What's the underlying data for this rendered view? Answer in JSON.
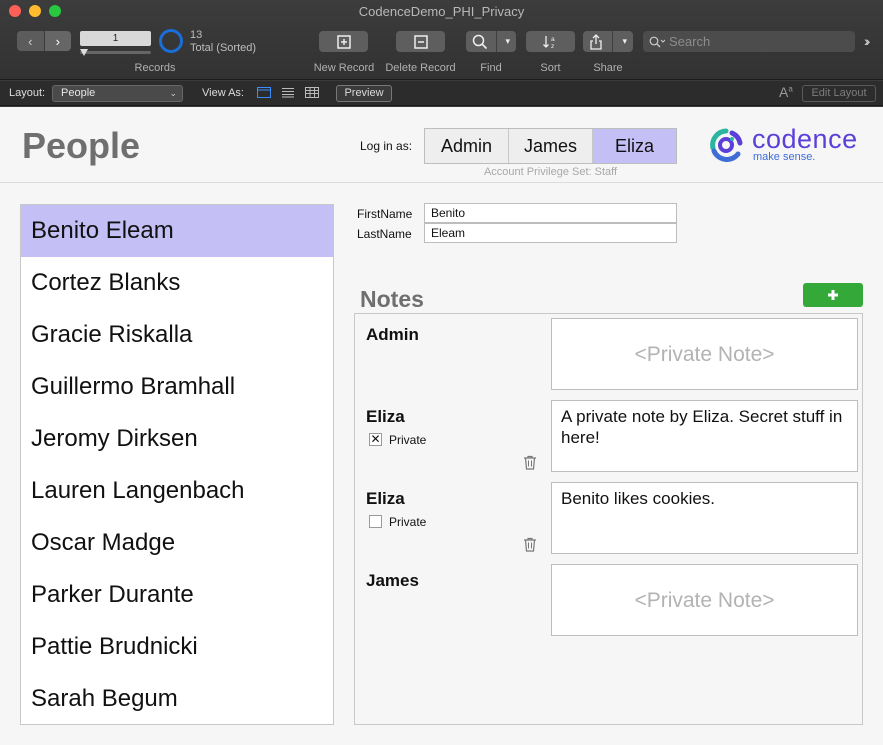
{
  "window": {
    "title": "CodenceDemo_PHI_Privacy"
  },
  "toolbar": {
    "current_record": "1",
    "found_count": "13",
    "found_status": "Total (Sorted)",
    "records_label": "Records",
    "new_record_label": "New Record",
    "delete_record_label": "Delete Record",
    "find_label": "Find",
    "sort_label": "Sort",
    "share_label": "Share",
    "search_placeholder": "Search"
  },
  "layoutbar": {
    "layout_label": "Layout:",
    "layout_value": "People",
    "view_as_label": "View As:",
    "preview_label": "Preview",
    "edit_layout_label": "Edit Layout"
  },
  "header": {
    "title": "People",
    "login_label": "Log in as:",
    "login_options": [
      "Admin",
      "James",
      "Eliza"
    ],
    "active_login": "Eliza",
    "privilege_set": "Account Privilege Set: Staff",
    "logo_text": "codence",
    "logo_tagline": "make sense."
  },
  "people": [
    "Benito Eleam",
    "Cortez Blanks",
    "Gracie Riskalla",
    "Guillermo Bramhall",
    "Jeromy Dirksen",
    "Lauren Langenbach",
    "Oscar Madge",
    "Parker Durante",
    "Pattie Brudnicki",
    "Sarah Begum"
  ],
  "selected_person": "Benito Eleam",
  "record": {
    "first_name_label": "FirstName",
    "first_name": "Benito",
    "last_name_label": "LastName",
    "last_name": "Eleam"
  },
  "notes": {
    "title": "Notes",
    "private_label": "Private",
    "items": [
      {
        "author": "Admin",
        "text": "<Private Note>",
        "is_placeholder": true,
        "show_private": false
      },
      {
        "author": "Eliza",
        "text": "A private note by Eliza. Secret stuff in here!",
        "is_placeholder": false,
        "show_private": true,
        "private": true
      },
      {
        "author": "Eliza",
        "text": "Benito likes cookies.",
        "is_placeholder": false,
        "show_private": true,
        "private": false
      },
      {
        "author": "James",
        "text": "<Private Note>",
        "is_placeholder": true,
        "show_private": false
      }
    ]
  },
  "colors": {
    "selection": "#c4bff5",
    "add_button": "#35a83a",
    "logo_purple": "#5b3fd8"
  }
}
